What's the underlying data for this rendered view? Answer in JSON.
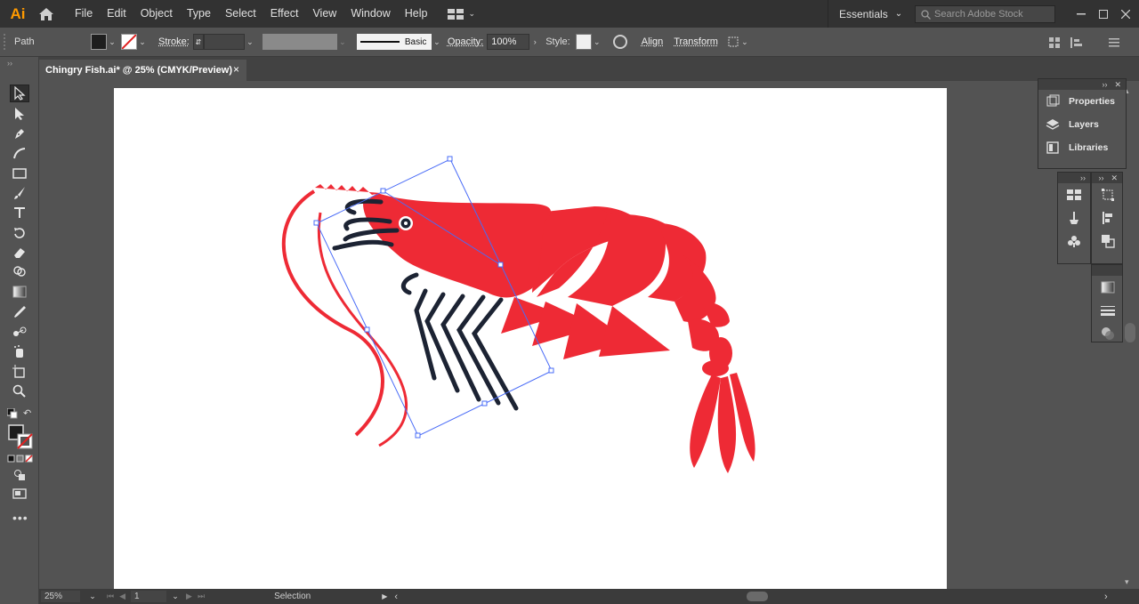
{
  "app": {
    "logo": "Ai"
  },
  "menu": [
    "File",
    "Edit",
    "Object",
    "Type",
    "Select",
    "Effect",
    "View",
    "Window",
    "Help"
  ],
  "workspace": "Essentials",
  "search": {
    "placeholder": "Search Adobe Stock"
  },
  "control": {
    "object_type": "Path",
    "stroke_label": "Stroke:",
    "brush_label": "Basic",
    "opacity_label": "Opacity:",
    "opacity_value": "100%",
    "style_label": "Style:",
    "align_label": "Align",
    "transform_label": "Transform"
  },
  "document": {
    "tab_title": "Chingry Fish.ai* @ 25% (CMYK/Preview)",
    "close": "×"
  },
  "panels": {
    "properties": "Properties",
    "layers": "Layers",
    "libraries": "Libraries"
  },
  "status": {
    "zoom": "25%",
    "artboard": "1",
    "tool": "Selection"
  },
  "colors": {
    "shrimp_red": "#ee2a35",
    "legs_dark": "#1c2333",
    "selection_blue": "#4a6cf7",
    "accent_orange": "#ff9a00"
  },
  "icons": [
    "home-icon",
    "selection-tool-icon",
    "direct-selection-icon",
    "pen-icon",
    "curvature-icon",
    "rectangle-icon",
    "paintbrush-icon",
    "type-icon",
    "rotate-icon",
    "eraser-icon",
    "shape-builder-icon",
    "gradient-icon",
    "eyedropper-icon",
    "blend-icon",
    "symbol-sprayer-icon",
    "artboard-icon",
    "zoom-icon",
    "search-icon"
  ]
}
